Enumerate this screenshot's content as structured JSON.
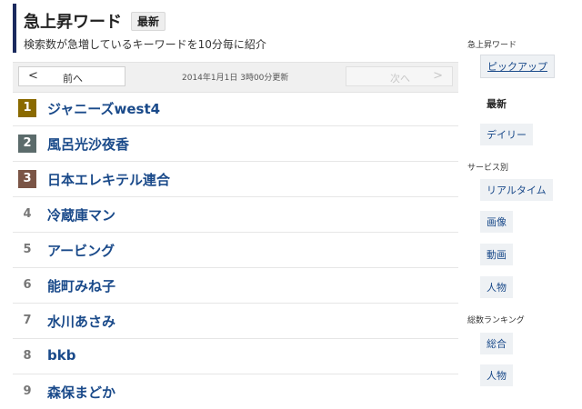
{
  "header": {
    "title": "急上昇ワード",
    "badge": "最新",
    "subtitle": "検索数が急増しているキーワードを10分毎に紹介"
  },
  "nav": {
    "prev_chevron": "<",
    "prev_label": "前へ",
    "updated": "2014年1月1日 3時00分更新",
    "next_label": "次へ",
    "next_chevron": ">"
  },
  "ranking": [
    {
      "rank": "1",
      "word": "ジャニーズwest4"
    },
    {
      "rank": "2",
      "word": "風呂光沙夜香"
    },
    {
      "rank": "3",
      "word": "日本エレキテル連合"
    },
    {
      "rank": "4",
      "word": "冷蔵庫マン"
    },
    {
      "rank": "5",
      "word": "アービング"
    },
    {
      "rank": "6",
      "word": "能町みね子"
    },
    {
      "rank": "7",
      "word": "水川あさみ"
    },
    {
      "rank": "8",
      "word": "bkb"
    },
    {
      "rank": "9",
      "word": "森保まどか"
    }
  ],
  "sidebar": {
    "section1": "急上昇ワード",
    "pickup": "ピックアップ",
    "latest": "最新",
    "daily": "デイリー",
    "section2": "サービス別",
    "realtime": "リアルタイム",
    "image": "画像",
    "video": "動画",
    "person1": "人物",
    "section3": "総数ランキング",
    "total": "総合",
    "person2": "人物"
  },
  "colors": {
    "accent_bar": "#1b2a5e",
    "link": "#1a4a8a",
    "rank1": "#8a6a00",
    "rank2": "#5b6b6b",
    "rank3": "#7b5546"
  }
}
